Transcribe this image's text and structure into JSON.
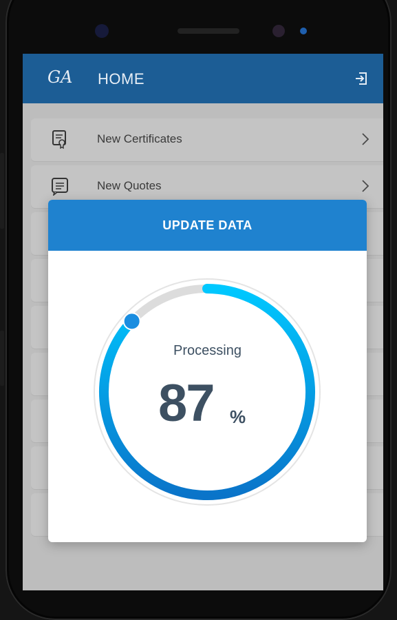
{
  "colors": {
    "appbar": "#1c5d95",
    "dialog_header": "#1f82cf",
    "progress_start": "#00c8ff",
    "progress_end": "#0a74c9",
    "track": "#dcdcdc",
    "text_dark": "#3d5062"
  },
  "header": {
    "logo_text": "GA",
    "title": "HOME",
    "logout_icon": "logout-icon"
  },
  "menu": {
    "items": [
      {
        "label": "New Certificates",
        "icon": "certificate-icon"
      },
      {
        "label": "New Quotes",
        "icon": "quote-icon"
      }
    ]
  },
  "dialog": {
    "title": "UPDATE DATA",
    "status": "Processing",
    "progress_value": "87",
    "progress_unit": "%",
    "progress_fraction": 0.87
  }
}
